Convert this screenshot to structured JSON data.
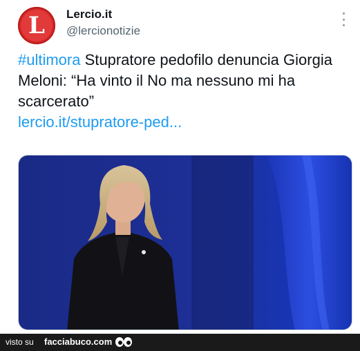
{
  "account": {
    "avatar_letter": "L",
    "name": "Lercio.it",
    "handle": "@lercionotizie"
  },
  "tweet": {
    "hashtag": "#ultimora",
    "body": " Stupratore pedofilo denuncia Giorgia Meloni: “Ha vinto il No ma nessuno mi ha scarcerato”",
    "link": "lercio.it/stupratore-ped..."
  },
  "footer": {
    "visto_su": "visto su",
    "brand": "facciabuco.com"
  },
  "colors": {
    "link": "#1d9bf0",
    "avatar": "#d42626",
    "media_bg": "#1b2e8c"
  },
  "icons": {
    "more": "more-vertical-icon",
    "eyes": "eyes-icon"
  }
}
